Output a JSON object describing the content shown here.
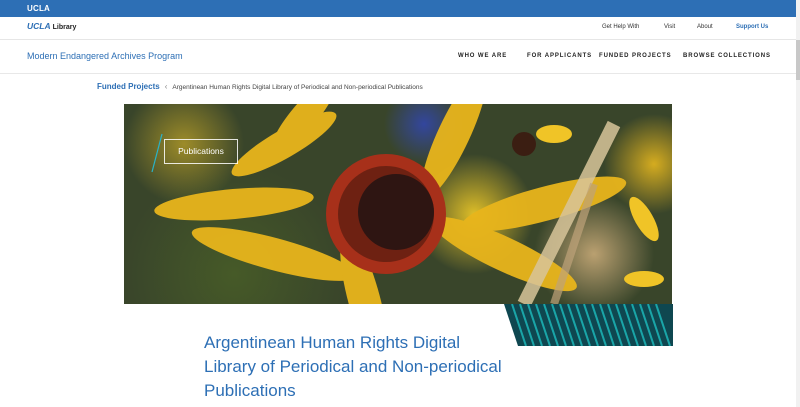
{
  "topbar": {
    "brand": "UCLA"
  },
  "library_bar": {
    "logo_ucla": "UCLA",
    "logo_library": "Library",
    "links": [
      "Get Help With",
      "Visit",
      "About"
    ],
    "support": "Support Us"
  },
  "main_nav": {
    "program": "Modern Endangered Archives Program",
    "items": [
      "WHO WE ARE",
      "FOR APPLICANTS",
      "FUNDED PROJECTS",
      "BROWSE COLLECTIONS"
    ]
  },
  "breadcrumb": {
    "parent": "Funded Projects",
    "separator": "‹",
    "current": "Argentinean Human Rights Digital Library of Periodical and Non-periodical Publications"
  },
  "hero": {
    "label": "Publications"
  },
  "page": {
    "title": "Argentinean Human Rights Digital Library of Periodical and Non-periodical Publications"
  },
  "colors": {
    "brand_blue": "#2d6fb5",
    "accent_teal": "#1aa5a8"
  }
}
